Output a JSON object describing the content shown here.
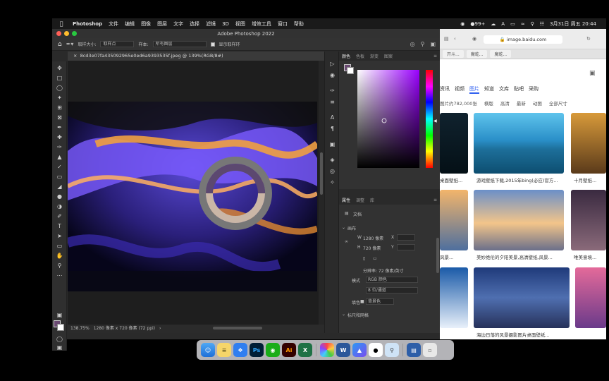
{
  "menubar": {
    "app": "Photoshop",
    "items": [
      "文件",
      "编辑",
      "图像",
      "图层",
      "文字",
      "选择",
      "滤镜",
      "3D",
      "视图",
      "增效工具",
      "窗口",
      "帮助"
    ],
    "status_extra": "99+",
    "datetime": "3月31日 周五  20:44"
  },
  "ps": {
    "window_title": "Adobe Photoshop 2022",
    "options": {
      "sample_size_label": "取样大小:",
      "sample_size_value": "取样点",
      "sample_label": "样本:",
      "sample_value": "所有图层",
      "show_ring_label": "显示取样环"
    },
    "doc_tab": "8cd3e07fa435092965e0ed6a9393535f.jpeg @ 139%(RGB/8#)",
    "status": {
      "zoom": "138.75%",
      "dims": "1280 像素 x 720 像素 (72 ppi)"
    },
    "color_panel": {
      "tabs": [
        "颜色",
        "色板",
        "渐变",
        "图案"
      ],
      "fg_color": "#6a4a72"
    },
    "props_panel": {
      "tabs": [
        "属性",
        "调整",
        "库"
      ],
      "doc_label": "文档",
      "canvas_section": "画布",
      "w_label": "W",
      "w_value": "1280 像素",
      "h_label": "H",
      "h_value": "720 像素",
      "x_label": "X",
      "y_label": "Y",
      "resolution": "分辨率: 72 像素/英寸",
      "mode_label": "模式",
      "mode_value": "RGB 颜色",
      "depth_value": "8 位/通道",
      "fill_label": "填色",
      "fill_value": "背景色",
      "rulers_section": "标尺和网格"
    }
  },
  "browser": {
    "url": "image.baidu.com",
    "tabs": [
      "开斗...",
      "魔乾...",
      "魔乾..."
    ],
    "nav": [
      "资讯",
      "视频",
      "图片",
      "知道",
      "文库",
      "贴吧",
      "采购"
    ],
    "active_nav": "图片",
    "result_hint": "图片约782,000张",
    "filters": [
      "横版",
      "高清",
      "最新",
      "动图",
      "全部尺寸"
    ],
    "captions": [
      "桌面壁纸...",
      "游戏壁纸下载,2015年bing(必应)官方...",
      "十月壁纸...",
      "风景...",
      "美妙绝伦的夕阳美景,高清壁纸,风景...",
      "唯美意境...",
      "海边日落的风景摄影图片桌面壁纸..."
    ]
  },
  "dock": {
    "apps": [
      "finder",
      "notes",
      "safari",
      "photoshop",
      "wechat",
      "illustrator",
      "excel",
      "photos",
      "word",
      "appstore",
      "qq",
      "preview",
      "desktop",
      "trash"
    ]
  }
}
